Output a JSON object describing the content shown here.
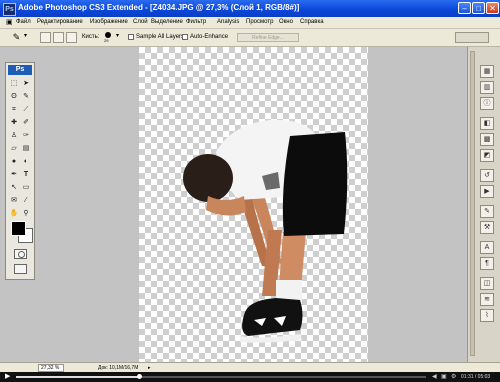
{
  "window": {
    "title": "Adobe Photoshop CS3 Extended - [Z4034.JPG @ 27,3% (Слой 1, RGB/8#)]",
    "app_badge": "Ps"
  },
  "menu": {
    "items": [
      "Файл",
      "Редактирование",
      "Изображение",
      "Слой",
      "Выделение",
      "Фильтр",
      "Analysis",
      "Просмотр",
      "Окно",
      "Справка"
    ]
  },
  "options": {
    "brush_label": "Кисть:",
    "brush_size": "29",
    "sample_all_layers": "Sample All Layers",
    "auto_enhance": "Auto-Enhance",
    "refine_edge": "Refine Edge..."
  },
  "tools": {
    "badge": "Ps",
    "foreground_color": "#000000",
    "background_color": "#ffffff"
  },
  "status": {
    "zoom": "27,32 %",
    "doc_info": "Док: 10,1M/16,7M"
  },
  "player": {
    "time": "01:31 / 05:03",
    "progress": 0.3
  }
}
